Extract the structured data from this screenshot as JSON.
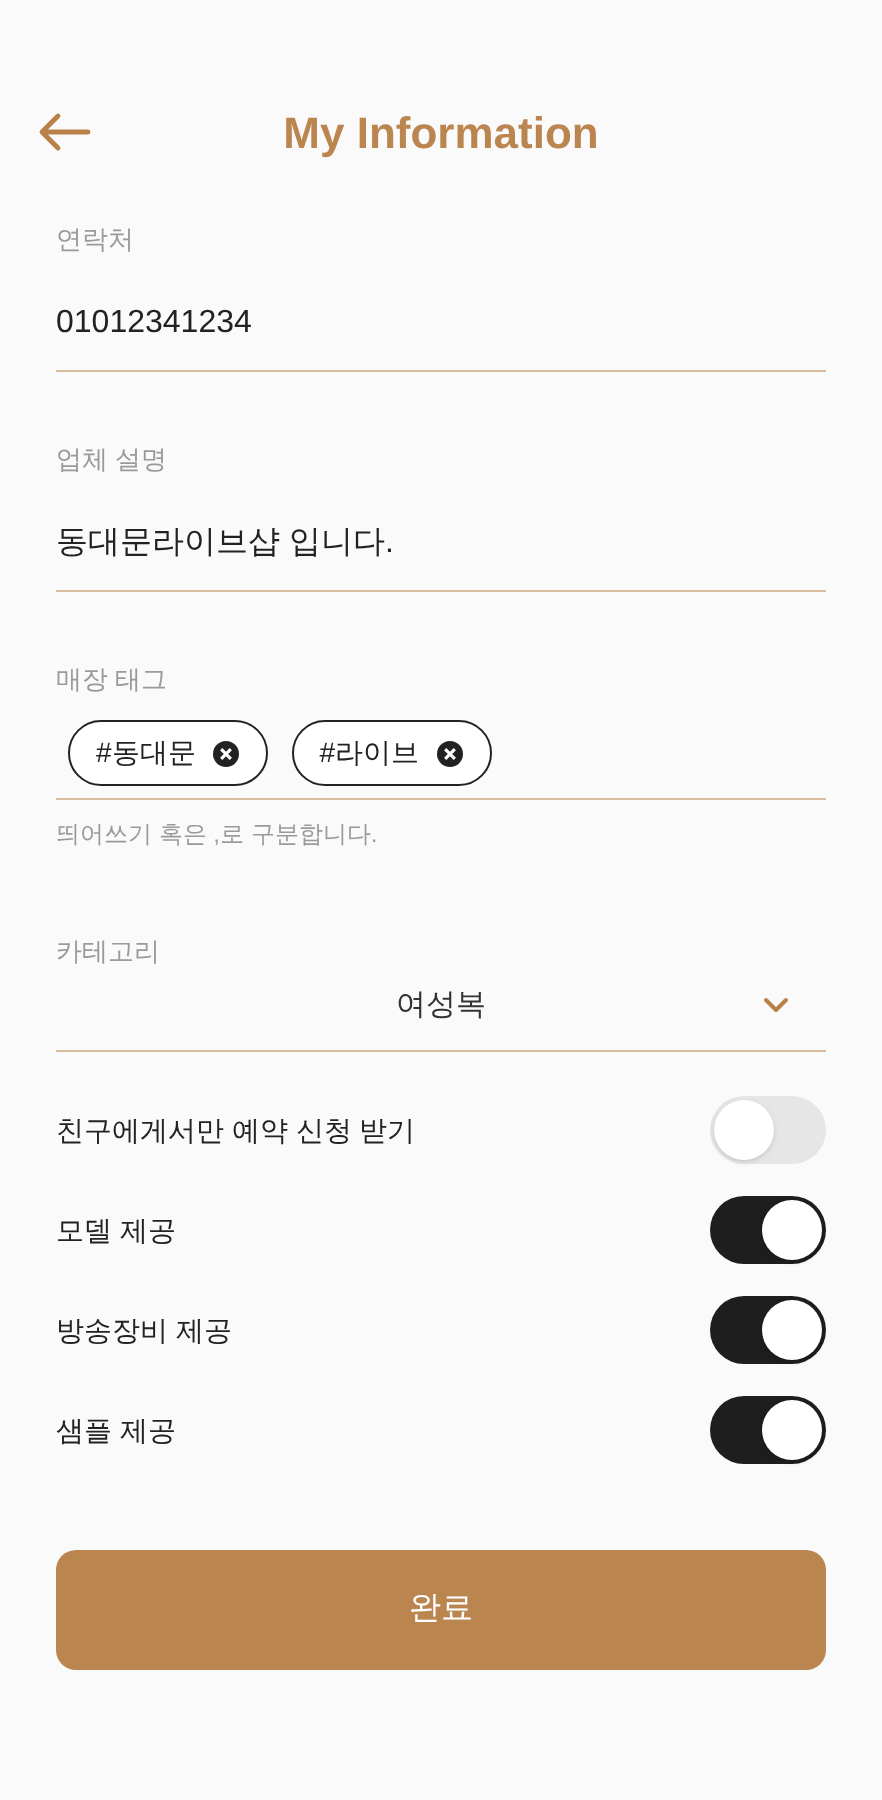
{
  "header": {
    "title": "My Information"
  },
  "fields": [
    {
      "kind": "text",
      "label": "연락처",
      "value": "01012341234"
    },
    {
      "kind": "text",
      "label": "업체 설명",
      "value": "동대문라이브샵 입니다."
    },
    {
      "kind": "tags",
      "label": "매장 태그",
      "tags": [
        "#동대문",
        "#라이브"
      ],
      "hint": "띄어쓰기 혹은 ,로 구분합니다."
    },
    {
      "kind": "select",
      "label": "카테고리",
      "value": "여성복"
    }
  ],
  "toggles": [
    {
      "label": "친구에게서만 예약 신청 받기",
      "on": false
    },
    {
      "label": "모델 제공",
      "on": true
    },
    {
      "label": "방송장비 제공",
      "on": true
    },
    {
      "label": "샘플 제공",
      "on": true
    }
  ],
  "submit": "완료"
}
